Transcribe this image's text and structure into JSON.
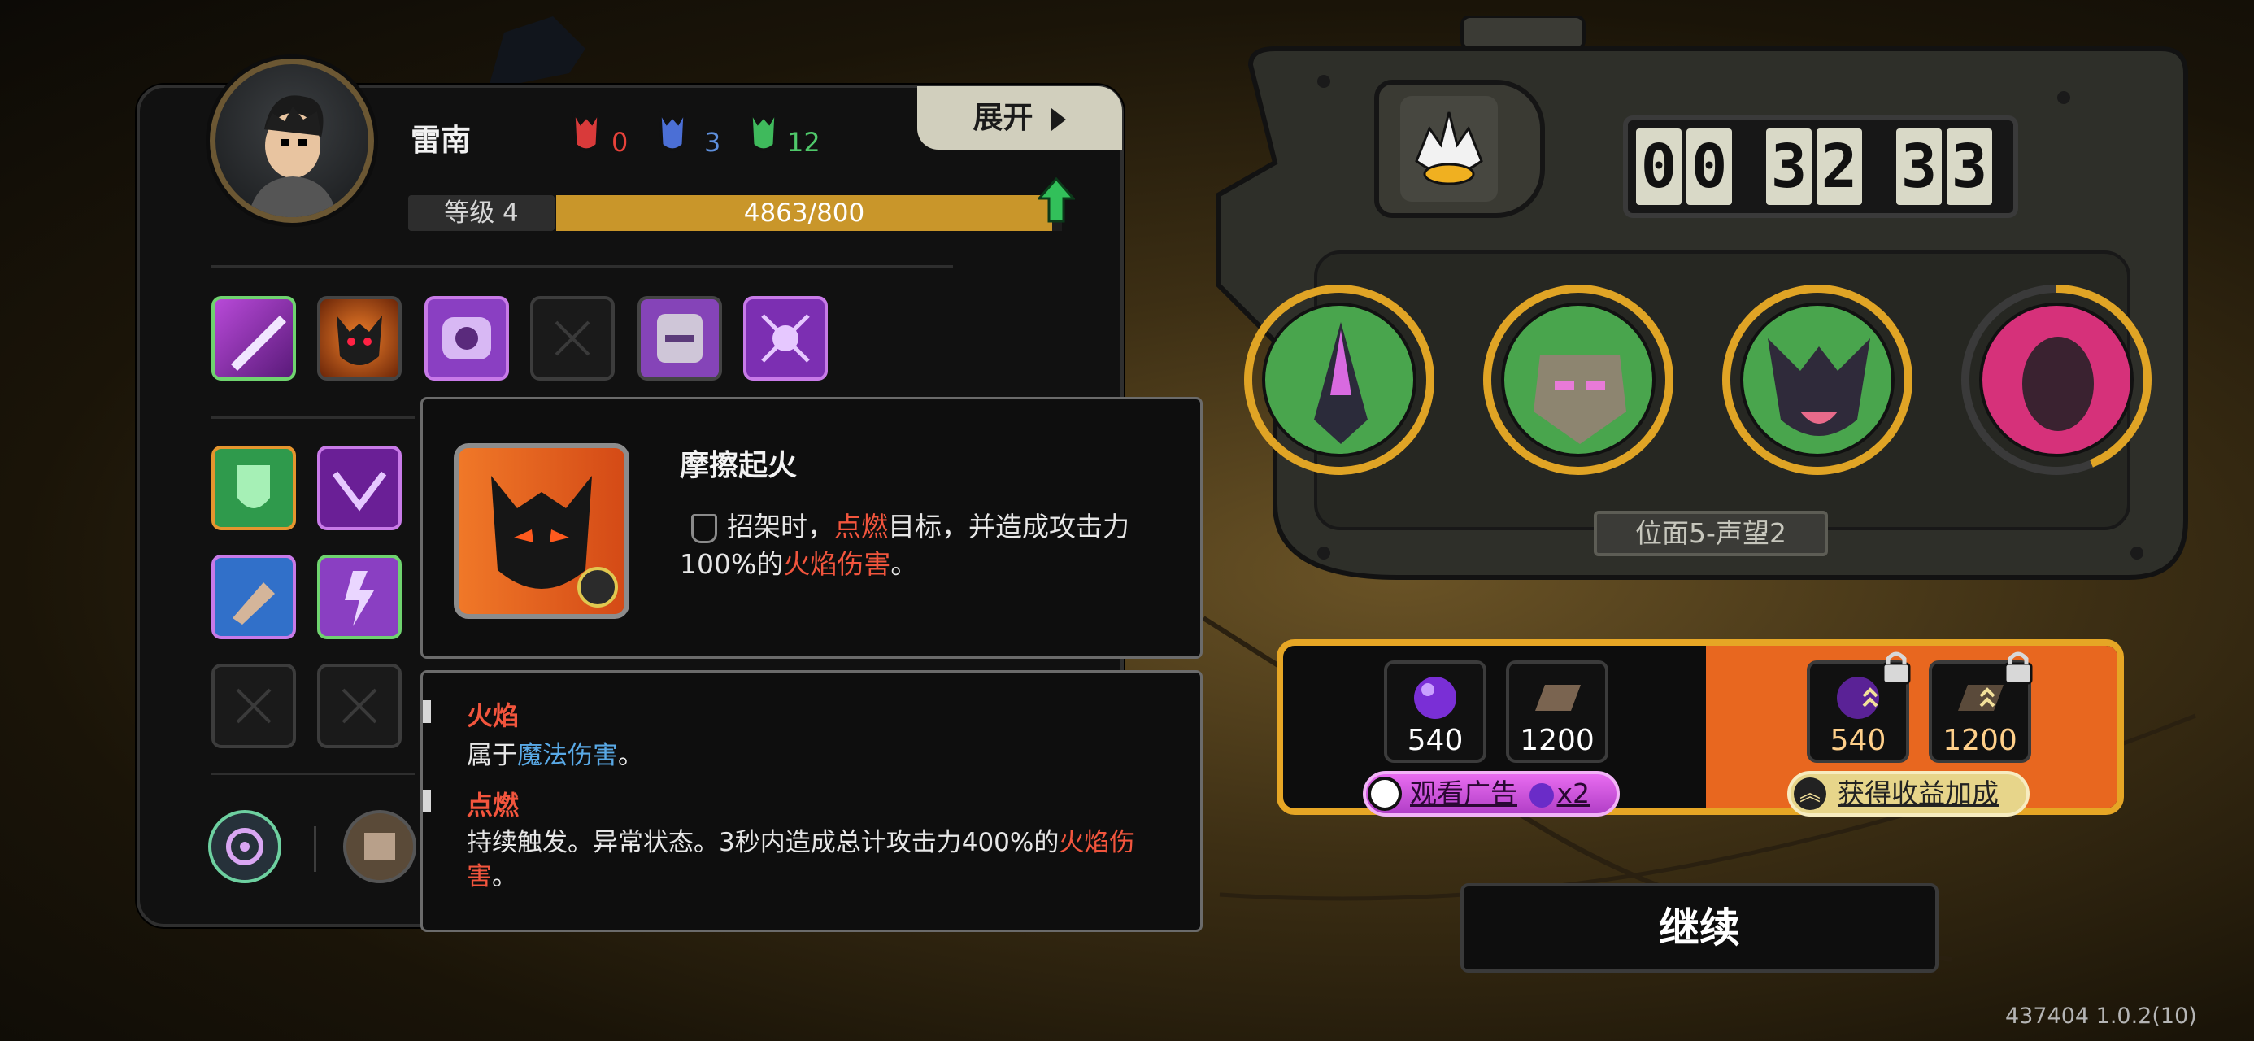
{
  "hero": {
    "name": "雷南",
    "stats": [
      {
        "icon": "red-demon-icon",
        "value": "0",
        "color": "#e8423a"
      },
      {
        "icon": "blue-demon-icon",
        "value": "3",
        "color": "#5e8fdc"
      },
      {
        "icon": "green-demon-icon",
        "value": "12",
        "color": "#4fc86a"
      }
    ],
    "level_label": "等级 4",
    "xp_text": "4863/800",
    "expand_label": "展开"
  },
  "tooltip": {
    "skill_name": "摩擦起火",
    "desc_part1": "招架时，",
    "desc_red1": "点燃",
    "desc_part2": "目标，并造成攻击力",
    "desc_part3": "100%的",
    "desc_red2": "火焰伤害",
    "desc_end": "。"
  },
  "glossary": {
    "term1": "火焰",
    "term1_prefix": "属于",
    "term1_link": "魔法伤害",
    "term1_end": "。",
    "term2": "点燃",
    "term2_desc": "持续触发。异常状态。3秒内造成总计攻击力400%的",
    "term2_red": "火焰伤害",
    "term2_end": "。"
  },
  "timer": {
    "digits": [
      "0",
      "0",
      "3",
      "2",
      "3",
      "3"
    ]
  },
  "stage_label": "位面5-声望2",
  "rewards": {
    "free": [
      {
        "icon": "purple-orb-icon",
        "value": "540"
      },
      {
        "icon": "book-icon",
        "value": "1200"
      }
    ],
    "bonus": [
      {
        "icon": "purple-orb-icon",
        "value": "540"
      },
      {
        "icon": "book-icon",
        "value": "1200"
      }
    ],
    "watch_ad_label": "观看广告",
    "watch_ad_multiplier": "x2",
    "gain_bonus_label": "获得收益加成"
  },
  "continue_label": "继续",
  "version": "437404 1.0.2(10)",
  "colors": {
    "gold": "#e0a425",
    "orange": "#e8671f",
    "red_text": "#f2553d",
    "blue_text": "#59a9e6"
  }
}
